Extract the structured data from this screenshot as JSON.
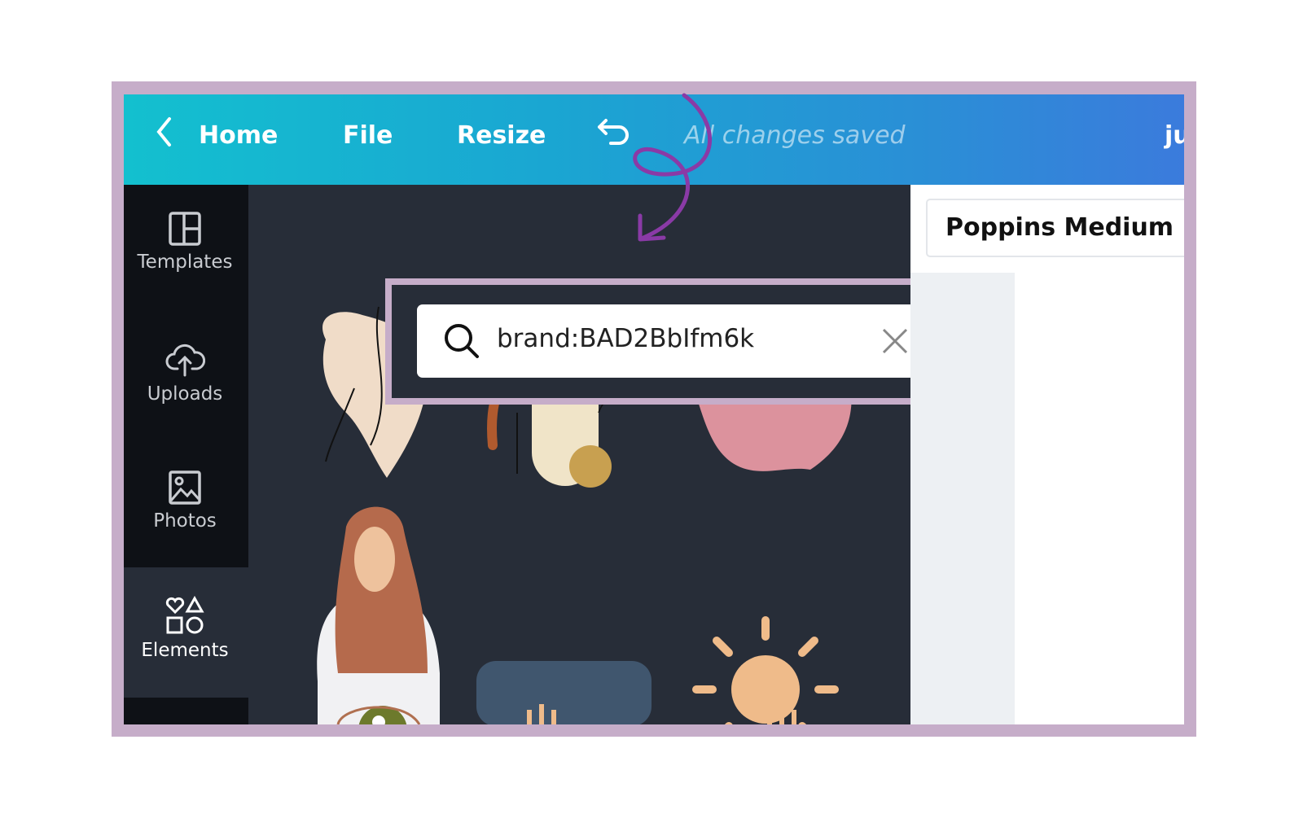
{
  "header": {
    "back_icon": "chevron-left-icon",
    "home": "Home",
    "file": "File",
    "resize": "Resize",
    "undo_icon": "undo-icon",
    "status": "All changes saved",
    "user_initials": "ju"
  },
  "sidebar": {
    "items": [
      {
        "label": "Templates",
        "icon": "templates-icon"
      },
      {
        "label": "Uploads",
        "icon": "cloud-upload-icon"
      },
      {
        "label": "Photos",
        "icon": "image-icon"
      },
      {
        "label": "Elements",
        "icon": "shapes-icon",
        "active": true
      }
    ]
  },
  "search": {
    "value": "brand:BAD2BbIfm6k",
    "search_icon": "search-icon",
    "clear_icon": "close-icon",
    "filter_icon": "sliders-icon"
  },
  "font_selector": {
    "value": "Poppins Medium"
  },
  "colors": {
    "frame": "#c6adc9",
    "annotation_arrow": "#8a3aa6",
    "panel_bg": "#272d38",
    "sidebar_bg": "#0e1116"
  }
}
